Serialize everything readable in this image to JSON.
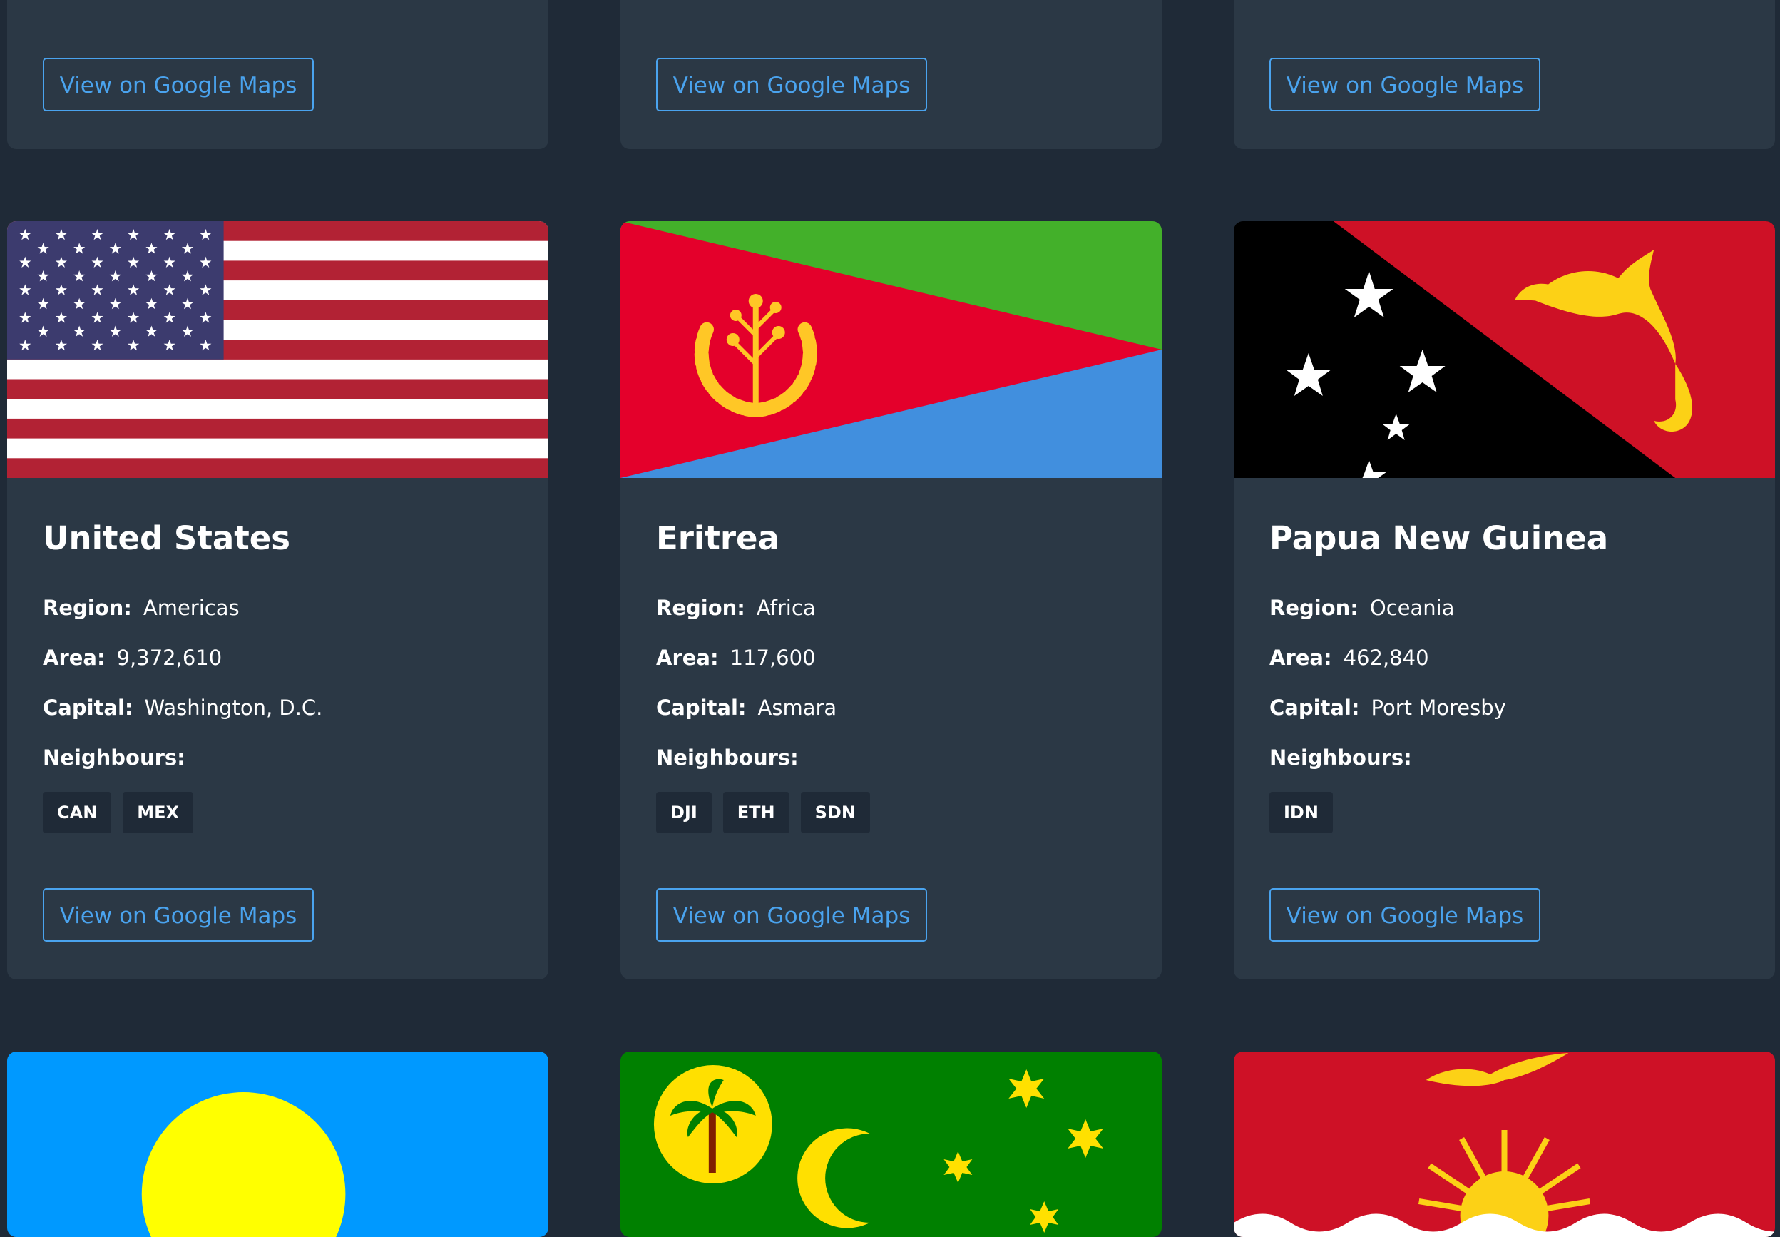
{
  "colors": {
    "page_bg": "#1f2a37",
    "card_bg": "#2b3845",
    "accent": "#4aa3ee",
    "tag_bg": "#1f2a37"
  },
  "labels": {
    "maps_button": "View on Google Maps",
    "region": "Region:",
    "area": "Area:",
    "capital": "Capital:",
    "neighbours": "Neighbours:"
  },
  "countries": [
    {
      "name": "United States",
      "flag_icon": "us-flag",
      "region": "Americas",
      "area": "9,372,610",
      "capital": "Washington, D.C.",
      "neighbours": [
        "CAN",
        "MEX"
      ]
    },
    {
      "name": "Eritrea",
      "flag_icon": "eritrea-flag",
      "region": "Africa",
      "area": "117,600",
      "capital": "Asmara",
      "neighbours": [
        "DJI",
        "ETH",
        "SDN"
      ]
    },
    {
      "name": "Papua New Guinea",
      "flag_icon": "papua-new-guinea-flag",
      "region": "Oceania",
      "area": "462,840",
      "capital": "Port Moresby",
      "neighbours": [
        "IDN"
      ]
    }
  ],
  "next_row_flags": [
    "palau-flag",
    "cocos-keeling-islands-flag",
    "kiribati-flag"
  ]
}
